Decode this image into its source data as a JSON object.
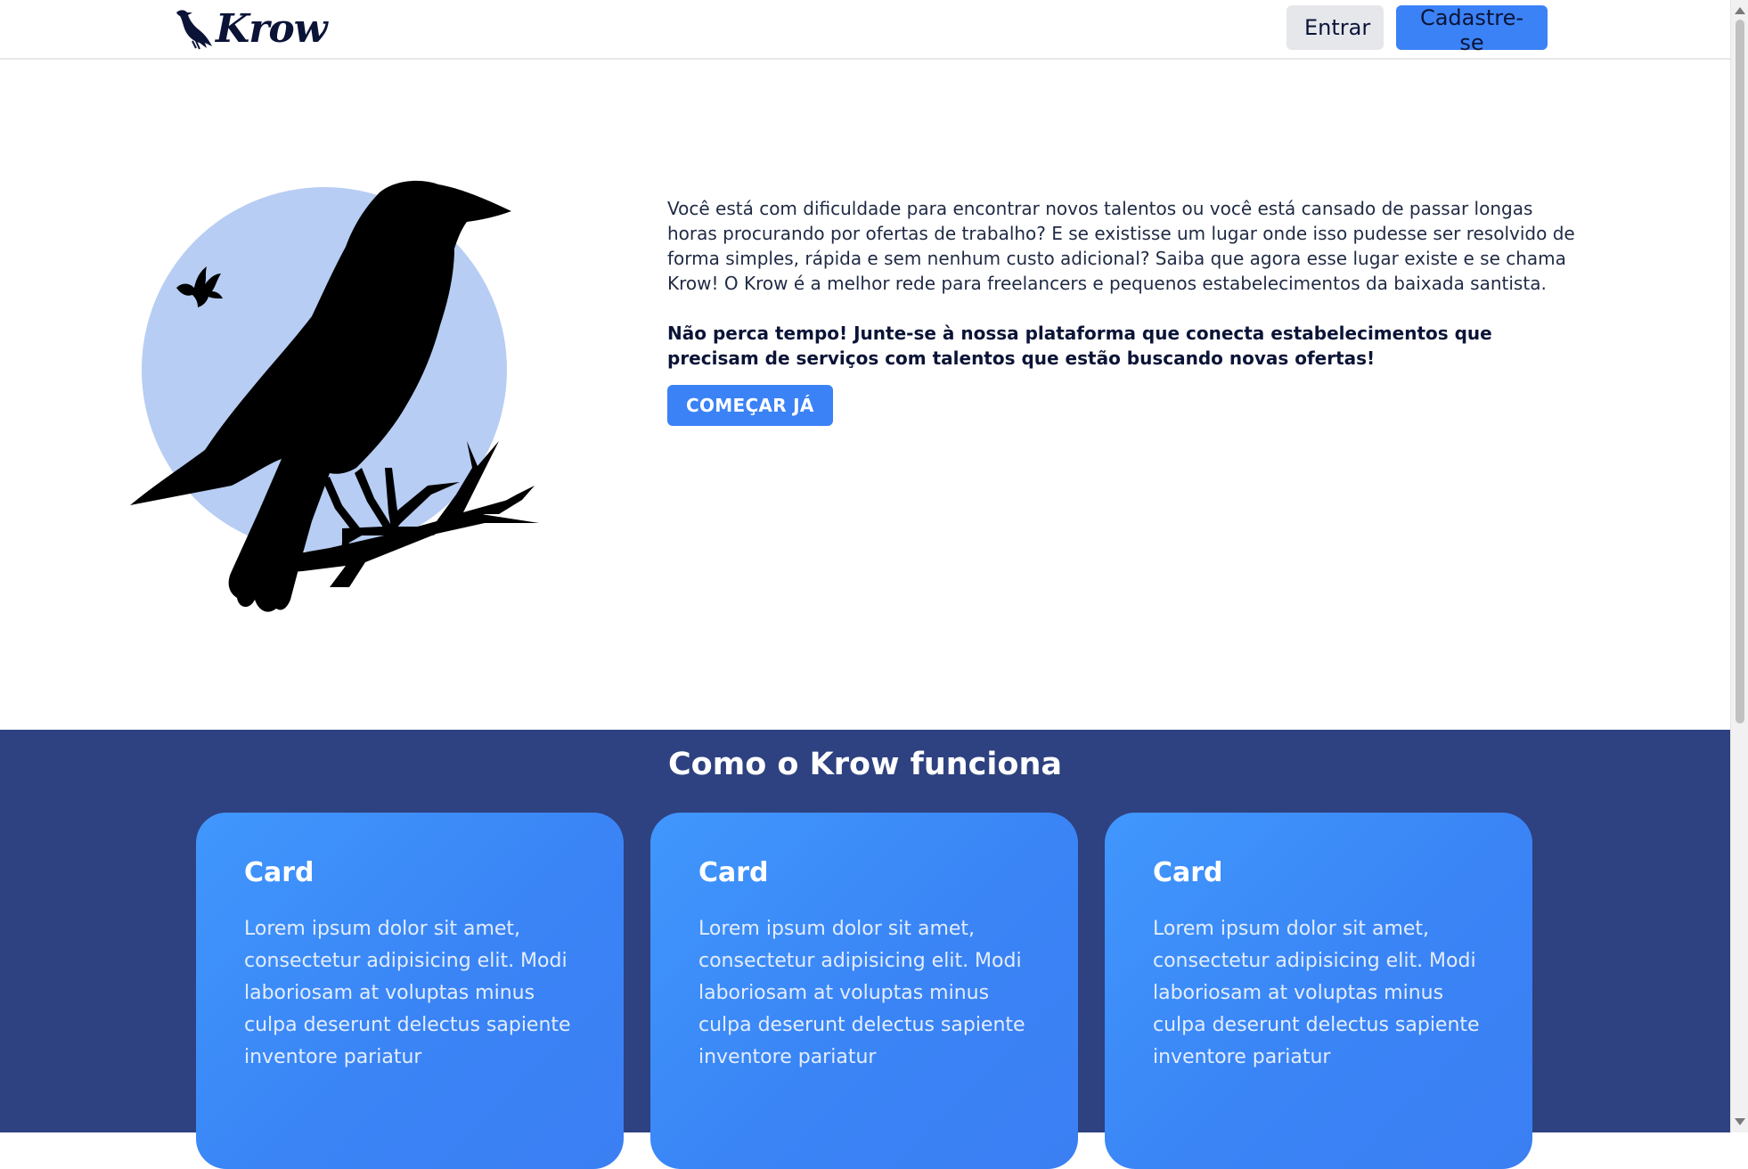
{
  "navbar": {
    "logo_text": "Krow",
    "login_label": "Entrar",
    "signup_label": "Cadastre-se"
  },
  "hero": {
    "paragraph": "Você está com dificuldade para encontrar novos talentos ou você está cansado de passar longas horas procurando por ofertas de trabalho? E se existisse um lugar onde isso pudesse ser resolvido de forma simples, rápida e sem nenhum custo adicional? Saiba que agora esse lugar existe e se chama Krow! O Krow é a melhor rede para freelancers e pequenos estabelecimentos da baixada santista.",
    "highlight": "Não perca tempo! Junte-se à nossa plataforma que conecta estabelecimentos que precisam de serviços com talentos que estão buscando novas ofertas!",
    "cta_label": "COMEÇAR JÁ",
    "illustration": "crow-on-branch-with-moon"
  },
  "how_it_works": {
    "title": "Como o Krow funciona",
    "cards": [
      {
        "title": "Card",
        "body": "Lorem ipsum dolor sit amet, consectetur adipisicing elit. Modi laboriosam at voluptas minus culpa deserunt delectus sapiente inventore pariatur"
      },
      {
        "title": "Card",
        "body": "Lorem ipsum dolor sit amet, consectetur adipisicing elit. Modi laboriosam at voluptas minus culpa deserunt delectus sapiente inventore pariatur"
      },
      {
        "title": "Card",
        "body": "Lorem ipsum dolor sit amet, consectetur adipisicing elit. Modi laboriosam at voluptas minus culpa deserunt delectus sapiente inventore pariatur"
      }
    ]
  },
  "colors": {
    "primary": "#3b82f6",
    "navy_text": "#0b1437",
    "section_bg": "#2e4180",
    "moon": "#b7cdf3",
    "secondary_button": "#e5e7eb"
  }
}
